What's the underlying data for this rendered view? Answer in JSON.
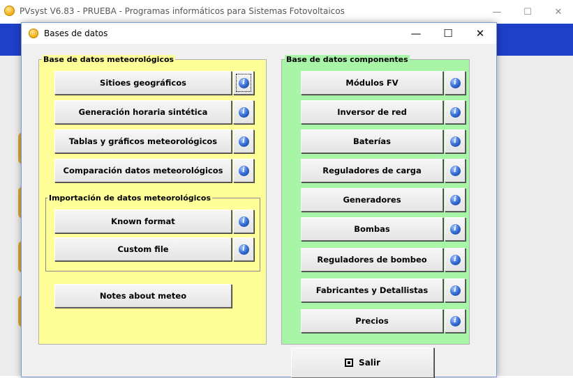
{
  "main_window": {
    "title": "PVsyst V6.83 - PRUEBA - Programas informáticos para Sistemas Fotovoltaicos",
    "controls": {
      "minimize": "—",
      "maximize": "☐",
      "close": "✕"
    }
  },
  "dialog": {
    "title": "Bases de datos",
    "controls": {
      "minimize": "—",
      "maximize": "☐",
      "close": "✕"
    }
  },
  "meteo": {
    "legend": "Base de datos meteorológicos",
    "buttons": [
      "Sitioes geográficos",
      "Generación horaria sintética",
      "Tablas y gráficos meteorológicos",
      "Comparación datos meteorológicos"
    ],
    "import": {
      "legend": "Importación de datos meteorológicos",
      "buttons": [
        "Known format",
        "Custom file"
      ]
    },
    "notes_button": "Notes about meteo"
  },
  "components": {
    "legend": "Base de datos componentes",
    "buttons": [
      "Módulos FV",
      "Inversor de red",
      "Baterías",
      "Reguladores de carga",
      "Generadores",
      "Bombas",
      "Reguladores de bombeo",
      "Fabricantes y Detallistas",
      "Precios"
    ]
  },
  "info_glyph": "i",
  "exit_button": "Salir",
  "colors": {
    "meteo_panel": "#ffff99",
    "components_panel": "#a8f5a8",
    "main_accent": "#1e40c8",
    "info_icon": "#2f68d0"
  },
  "icons": {
    "app": "pvsyst-sun-icon",
    "info": "info-icon",
    "exit": "exit-icon"
  }
}
